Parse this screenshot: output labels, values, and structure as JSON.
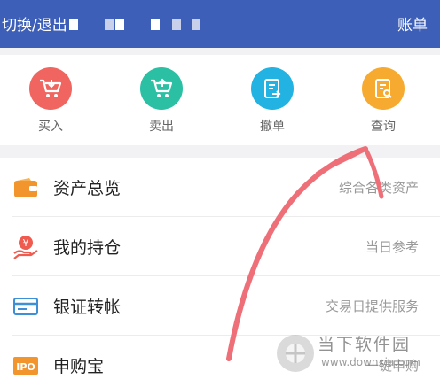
{
  "header": {
    "switch_label": "切换/退出",
    "account_label": "账单"
  },
  "actions": [
    {
      "label": "买入",
      "color": "#f0655f",
      "icon": "cart-buy-icon"
    },
    {
      "label": "卖出",
      "color": "#2bbfa4",
      "icon": "cart-sell-icon"
    },
    {
      "label": "撤单",
      "color": "#22b3e2",
      "icon": "cancel-order-icon"
    },
    {
      "label": "查询",
      "color": "#f6ab30",
      "icon": "query-icon"
    }
  ],
  "menu": [
    {
      "title": "资产总览",
      "hint": "综合各类资产",
      "icon": "wallet-icon",
      "color": "#f2952c"
    },
    {
      "title": "我的持仓",
      "hint": "当日参考",
      "icon": "holdings-icon",
      "color": "#ef5b4f"
    },
    {
      "title": "银证转帐",
      "hint": "交易日提供服务",
      "icon": "bank-card-icon",
      "color": "#3d8fd6"
    },
    {
      "title": "申购宝",
      "hint": "一键申购",
      "icon": "ipo-icon",
      "color": "#f2952c",
      "badge": "IPO"
    }
  ],
  "watermark": {
    "text": "当下软件园",
    "url": "www.downxia.com"
  },
  "colors": {
    "header_bg": "#3d5fb8",
    "swipe": "#ef6f78"
  }
}
